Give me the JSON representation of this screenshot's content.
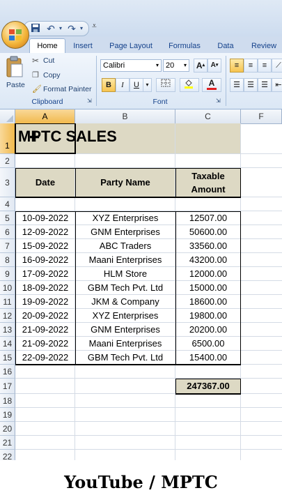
{
  "qat": {
    "more": "₹"
  },
  "tabs": [
    "Home",
    "Insert",
    "Page Layout",
    "Formulas",
    "Data",
    "Review"
  ],
  "ribbon": {
    "clipboard": {
      "paste": "Paste",
      "cut": "Cut",
      "copy": "Copy",
      "format_painter": "Format Painter",
      "label": "Clipboard"
    },
    "font": {
      "name": "Calibri",
      "size": "20",
      "label": "Font"
    }
  },
  "columns": [
    "A",
    "B",
    "C",
    "F"
  ],
  "rows": [
    "1",
    "2",
    "3",
    "4",
    "5",
    "6",
    "7",
    "8",
    "9",
    "10",
    "11",
    "12",
    "13",
    "14",
    "15",
    "16",
    "17",
    "18",
    "19",
    "20",
    "21",
    "22"
  ],
  "sheet": {
    "title": "MPTC SALES",
    "headers": {
      "date": "Date",
      "party": "Party Name",
      "amount_line1": "Taxable",
      "amount_line2": "Amount"
    },
    "data": [
      [
        "10-09-2022",
        "XYZ Enterprises",
        "12507.00"
      ],
      [
        "12-09-2022",
        "GNM Enterprises",
        "50600.00"
      ],
      [
        "15-09-2022",
        "ABC Traders",
        "33560.00"
      ],
      [
        "16-09-2022",
        "Maani Enterprises",
        "43200.00"
      ],
      [
        "17-09-2022",
        "HLM Store",
        "12000.00"
      ],
      [
        "18-09-2022",
        "GBM Tech Pvt. Ltd",
        "15000.00"
      ],
      [
        "19-09-2022",
        "JKM & Company",
        "18600.00"
      ],
      [
        "20-09-2022",
        "XYZ Enterprises",
        "19800.00"
      ],
      [
        "21-09-2022",
        "GNM Enterprises",
        "20200.00"
      ],
      [
        "21-09-2022",
        "Maani Enterprises",
        "6500.00"
      ],
      [
        "22-09-2022",
        "GBM Tech Pvt. Ltd",
        "15400.00"
      ]
    ],
    "total": "247367.00"
  },
  "caption": "YouTube / MPTC",
  "colors": {
    "header_fill": "#ddd9c4",
    "selection": "#f1b94c",
    "ribbon": "#dbe7f5"
  }
}
